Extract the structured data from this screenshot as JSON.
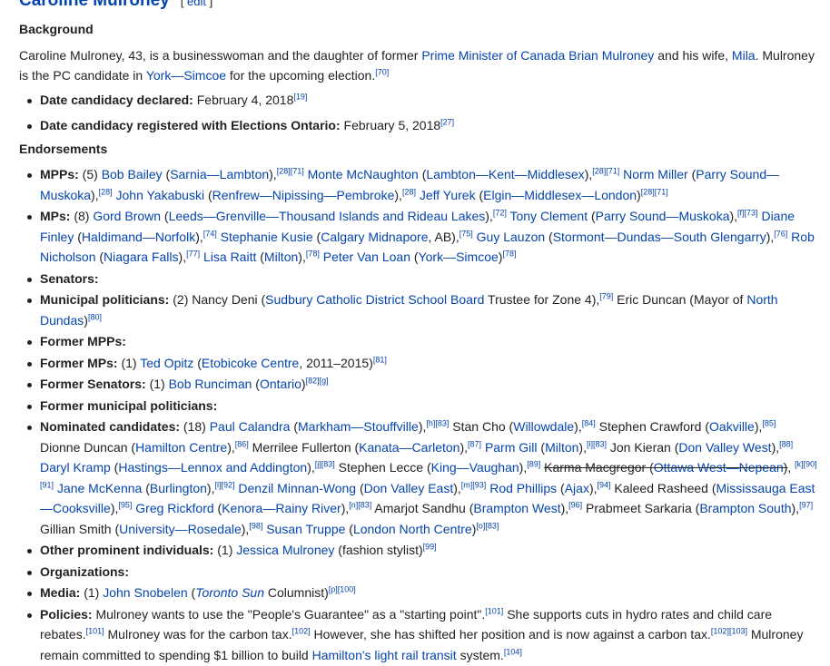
{
  "section": {
    "title": "Caroline Mulroney",
    "edit_open": "[ ",
    "edit_label": "edit",
    "edit_close": " ]"
  },
  "background_heading": "Background",
  "bg": {
    "t1": "Caroline Mulroney, 43, is a businesswoman and the daughter of former ",
    "l1": "Prime Minister of Canada Brian Mulroney",
    "t2": " and his wife, ",
    "l2": "Mila",
    "t3": ". Mulroney is the PC candidate in ",
    "l3": "York—Simcoe",
    "t4": " for the upcoming election.",
    "r1": "[70]"
  },
  "dates": {
    "declared_label": "Date candidacy declared:",
    "declared_value": " February 4, 2018",
    "declared_ref": "[19]",
    "registered_label": "Date candidacy registered with Elections Ontario:",
    "registered_value": " February 5, 2018",
    "registered_ref": "[27]"
  },
  "endorsements_heading": "Endorsements",
  "e": {
    "mpps_label": "MPPs:",
    "mpps_count": " (5) ",
    "m1": "Bob Bailey",
    "m1o": " (",
    "m1r": "Sarnia—Lambton",
    "m1c": "),",
    "m1ref": "[28][71]",
    "m2": "Monte McNaughton",
    "m2r": "Lambton—Kent—Middlesex",
    "m2ref": "[28][71]",
    "m3": "Norm Miller",
    "m3r": "Parry Sound—Muskoka",
    "m3ref": "[28]",
    "m4": "John Yakabuski",
    "m4r": "Renfrew—Nipissing—Pembroke",
    "m4ref": "[28]",
    "m5": "Jeff Yurek",
    "m5r": "Elgin—Middlesex—London",
    "m5ref": "[28][71]",
    "mps_label": "MPs:",
    "mps_count": " (8) ",
    "p1": "Gord Brown",
    "p1r": "Leeds—Grenville—Thousand Islands and Rideau Lakes",
    "p1ref": "[72]",
    "p2": "Tony Clement",
    "p2r": "Parry Sound—Muskoka",
    "p2ref": "[f][73]",
    "p3": "Diane Finley",
    "p3r": "Haldimand—Norfolk",
    "p3ref": "[74]",
    "p4": "Stephanie Kusie",
    "p4r": "Calgary Midnapore",
    "p4ab": ", AB),",
    "p4ref": "[75]",
    "p5": "Guy Lauzon",
    "p5r": "Stormont—Dundas—South Glengarry",
    "p5ref": "[76]",
    "p6": "Rob Nicholson",
    "p6r": "Niagara Falls",
    "p6ref": "[77]",
    "p7": "Lisa Raitt",
    "p7r": "Milton",
    "p7ref": "[78]",
    "p8": "Peter Van Loan",
    "p8r": "York—Simcoe",
    "p8ref": "[78]",
    "senators_label": "Senators:",
    "muni_label": "Municipal politicians:",
    "muni_t1": " (2) Nancy Deni (",
    "muni_l1": "Sudbury Catholic District School Board",
    "muni_t2": " Trustee for Zone 4),",
    "muni_r1": "[79]",
    "muni_t3": " Eric Duncan (Mayor of ",
    "muni_l2": "North Dundas",
    "muni_t4": ")",
    "muni_r2": "[80]",
    "fmpps_label": "Former MPPs:",
    "fmps_label": "Former MPs:",
    "fmps_count": " (1) ",
    "fmps_l1": "Ted Opitz",
    "fmps_l2": "Etobicoke Centre",
    "fmps_t1": ", 2011–2015)",
    "fmps_ref": "[81]",
    "fsen_label": "Former Senators:",
    "fsen_count": " (1) ",
    "fsen_l1": "Bob Runciman",
    "fsen_l2": "Ontario",
    "fsen_ref": "[82][g]",
    "fmuni_label": "Former municipal politicians:",
    "nom_label": "Nominated candidates:",
    "nom_count": " (18) ",
    "n1": "Paul Calandra",
    "n1r": "Markham—Stouffville",
    "n1ref": "[h][83]",
    "n2": " Stan Cho (",
    "n2r": "Willowdale",
    "n2ref": "[84]",
    "n3": " Stephen Crawford (",
    "n3r": "Oakville",
    "n3ref": "[85]",
    "n4": "Dionne Duncan (",
    "n4r": "Hamilton Centre",
    "n4ref": "[86]",
    "n5": " Merrilee Fullerton (",
    "n5r": "Kanata—Carleton",
    "n5ref": "[87]",
    "n6": "Parm Gill",
    "n6r": "Milton",
    "n6ref": "[i][83]",
    "n7": " Jon Kieran (",
    "n7r": "Don Valley West",
    "n7ref": "[88]",
    "n8": "Daryl Kramp",
    "n8r": "Hastings—Lennox and Addington",
    "n8ref": "[j][83]",
    "n9": " Stephen Lecce (",
    "n9r": "King—Vaughan",
    "n9ref": "[89]",
    "n10": "Karma Macgregor",
    "n10r": "Ottawa West—Nepean",
    "n10ref": "[k][90][91]",
    "n11": "Jane McKenna",
    "n11r": "Burlington",
    "n11ref": "[l][92]",
    "n12": "Denzil Minnan-Wong",
    "n12r": "Don Valley East",
    "n12ref": "[m][93]",
    "n13": "Rod Phillips",
    "n13r": "Ajax",
    "n13ref": "[94]",
    "n14": " Kaleed Rasheed (",
    "n14r": "Mississauga East—Cooksville",
    "n14ref": "[95]",
    "n15": "Greg Rickford",
    "n15r": "Kenora—Rainy River",
    "n15ref": "[n][83]",
    "n16": " Amarjot Sandhu (",
    "n16r": "Brampton West",
    "n16ref": "[96]",
    "n17": " Prabmeet Sarkaria (",
    "n17r": "Brampton South",
    "n17ref": "[97]",
    "n18": " Gillian Smith (",
    "n18r": "University—Rosedale",
    "n18ref": "[98]",
    "n19": "Susan Truppe",
    "n19r": "London North Centre",
    "n19ref": "[o][83]",
    "other_label": "Other prominent individuals:",
    "other_count": " (1) ",
    "other_l1": "Jessica Mulroney",
    "other_t1": " (fashion stylist)",
    "other_ref": "[99]",
    "org_label": "Organizations:",
    "media_label": "Media:",
    "media_count": " (1) ",
    "media_l1": "John Snobelen",
    "media_l2": "Toronto Sun",
    "media_t1": " Columnist)",
    "media_ref": "[p][100]",
    "pol_label": "Policies:",
    "pol_t1": " Mulroney wants to use the \"People's Guarantee\" as a \"starting point\".",
    "pol_r1": "[101]",
    "pol_t2": " She supports cuts in hydro rates and child care rebates.",
    "pol_r2": "[101]",
    "pol_t3": " Mulroney was for the carbon tax.",
    "pol_r3": "[102]",
    "pol_t4": " However, she has shifted her position and is now against a carbon tax.",
    "pol_r4": "[102][103]",
    "pol_t5": " Mulroney remain committed to spending $1 billion to build ",
    "pol_l1": "Hamilton's light rail transit",
    "pol_t6": " system.",
    "pol_r5": "[104]"
  }
}
